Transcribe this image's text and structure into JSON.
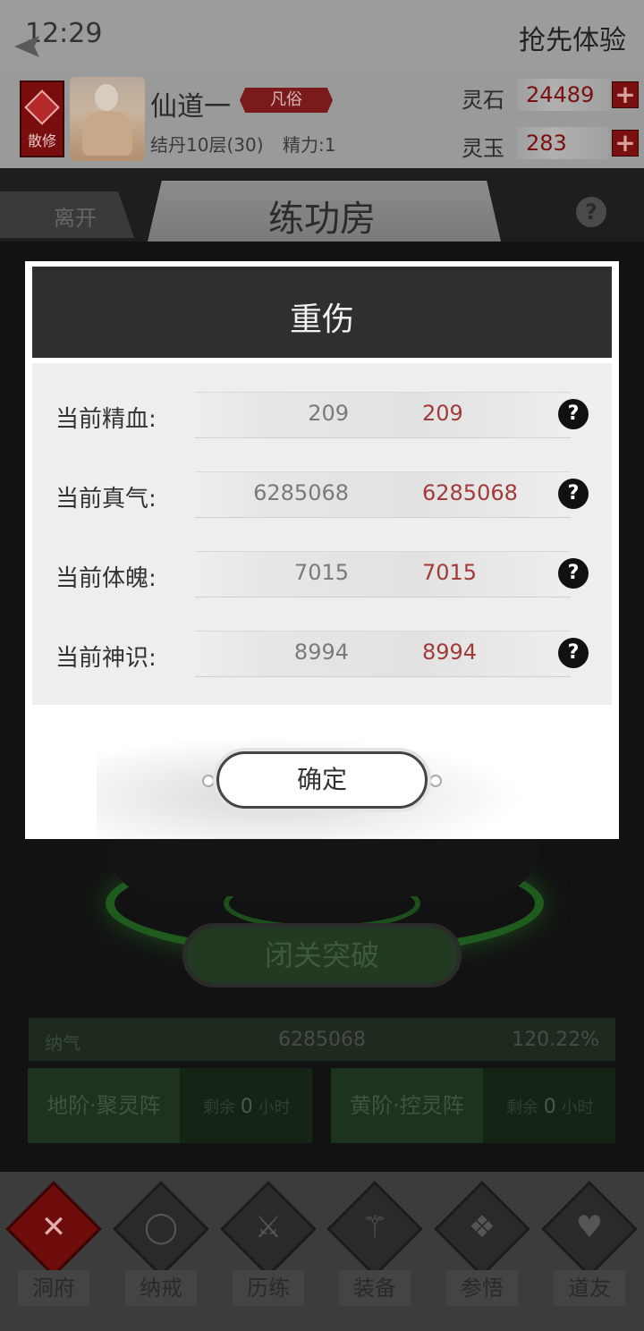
{
  "status_bar": {
    "time": "12:29",
    "experience": "抢先体验"
  },
  "player": {
    "sect_badge": "散修",
    "name": "仙道一",
    "rank": "凡俗",
    "realm": "结丹10层(30)",
    "energy": "精力:1"
  },
  "resources": [
    {
      "label": "灵石",
      "value": "24489"
    },
    {
      "label": "灵玉",
      "value": "283"
    }
  ],
  "titlebar": {
    "leave": "离开",
    "title": "练功房",
    "help": "?"
  },
  "modal": {
    "title": "重伤",
    "rows": [
      {
        "label": "当前精血:",
        "current": "209",
        "max": "209"
      },
      {
        "label": "当前真气:",
        "current": "6285068",
        "max": "6285068"
      },
      {
        "label": "当前体魄:",
        "current": "7015",
        "max": "7015"
      },
      {
        "label": "当前神识:",
        "current": "8994",
        "max": "8994"
      }
    ],
    "help_glyph": "?",
    "confirm": "确定"
  },
  "stage": {
    "retreat_button": "闭关突破",
    "gauge": {
      "label": "纳气",
      "value": "6285068",
      "percent": "120.22%"
    },
    "arrays": [
      {
        "name": "地阶·聚灵阵",
        "remaining_prefix": "剩余",
        "remaining_value": "0",
        "remaining_unit": "小时"
      },
      {
        "name": "黄阶·控灵阵",
        "remaining_prefix": "剩余",
        "remaining_value": "0",
        "remaining_unit": "小时"
      }
    ]
  },
  "bottom_nav": [
    {
      "label": "洞府",
      "icon": "close-x-icon",
      "glyph": "✕",
      "active": true
    },
    {
      "label": "纳戒",
      "icon": "ring-icon",
      "glyph": "◯",
      "active": false
    },
    {
      "label": "历练",
      "icon": "crossed-swords-icon",
      "glyph": "⚔",
      "active": false
    },
    {
      "label": "装备",
      "icon": "sword-icon",
      "glyph": "⚚",
      "active": false
    },
    {
      "label": "参悟",
      "icon": "open-book-icon",
      "glyph": "❖",
      "active": false
    },
    {
      "label": "道友",
      "icon": "heart-hands-icon",
      "glyph": "♥",
      "active": false
    }
  ],
  "colors": {
    "accent_red": "#7a1010",
    "value_red": "#a23a3a",
    "modal_header": "#2f2f2f"
  }
}
